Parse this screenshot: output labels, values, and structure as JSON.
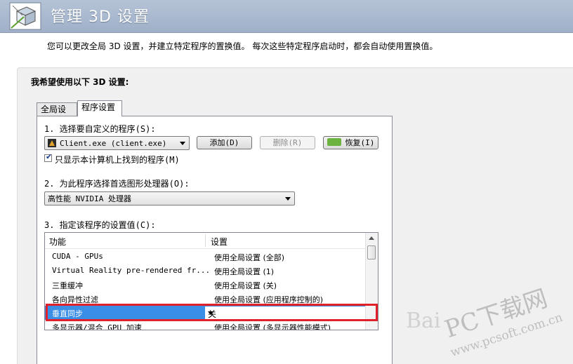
{
  "header": {
    "title": "管理 3D 设置",
    "logo_icon": "nvidia-3d-cube-icon"
  },
  "description": "您可以更改全局 3D 设置，并建立特定程序的置换值。 每次这些特定程序启动时，都会自动使用置换值。",
  "panel": {
    "heading": "我希望使用以下 3D 设置:",
    "tabs": [
      {
        "label": "全局设置",
        "active": false
      },
      {
        "label": "程序设置",
        "active": true
      }
    ],
    "step1": {
      "label": "1. 选择要自定义的程序(S):",
      "program": "Client.exe (client.exe)",
      "add_button": "添加(D)",
      "remove_button": "删除(R)",
      "restore_button": "恢复(I)",
      "checkbox_label": "只显示本计算机上找到的程序(M)",
      "checkbox_checked": true
    },
    "step2": {
      "label": "2. 为此程序选择首选图形处理器(O):",
      "processor": "高性能 NVIDIA 处理器"
    },
    "step3": {
      "label": "3. 指定该程序的设置值(C):",
      "columns": [
        "功能",
        "设置"
      ],
      "rows": [
        {
          "feature": "CUDA - GPUs",
          "setting": "使用全局设置 (全部)"
        },
        {
          "feature": "Virtual Reality pre-rendered fr...",
          "setting": "使用全局设置 (1)"
        },
        {
          "feature": "三重缓冲",
          "setting": "使用全局设置 (关)"
        },
        {
          "feature": "各向异性过滤",
          "setting": "使用全局设置 (应用程序控制的)"
        },
        {
          "feature": "垂直同步",
          "setting": "关",
          "selected": true
        },
        {
          "feature": "多显示器/混合 GPU 加速",
          "setting": "使用全局设置 (多显示器性能模式)"
        }
      ]
    }
  },
  "watermark": {
    "main": "PC下载网",
    "url": "www.pcsoft.com.cn",
    "baidu": "Bai"
  },
  "colors": {
    "selection": "#3a8ee6",
    "highlight_box": "#e0202a",
    "header_bg": "#aab9ce"
  }
}
